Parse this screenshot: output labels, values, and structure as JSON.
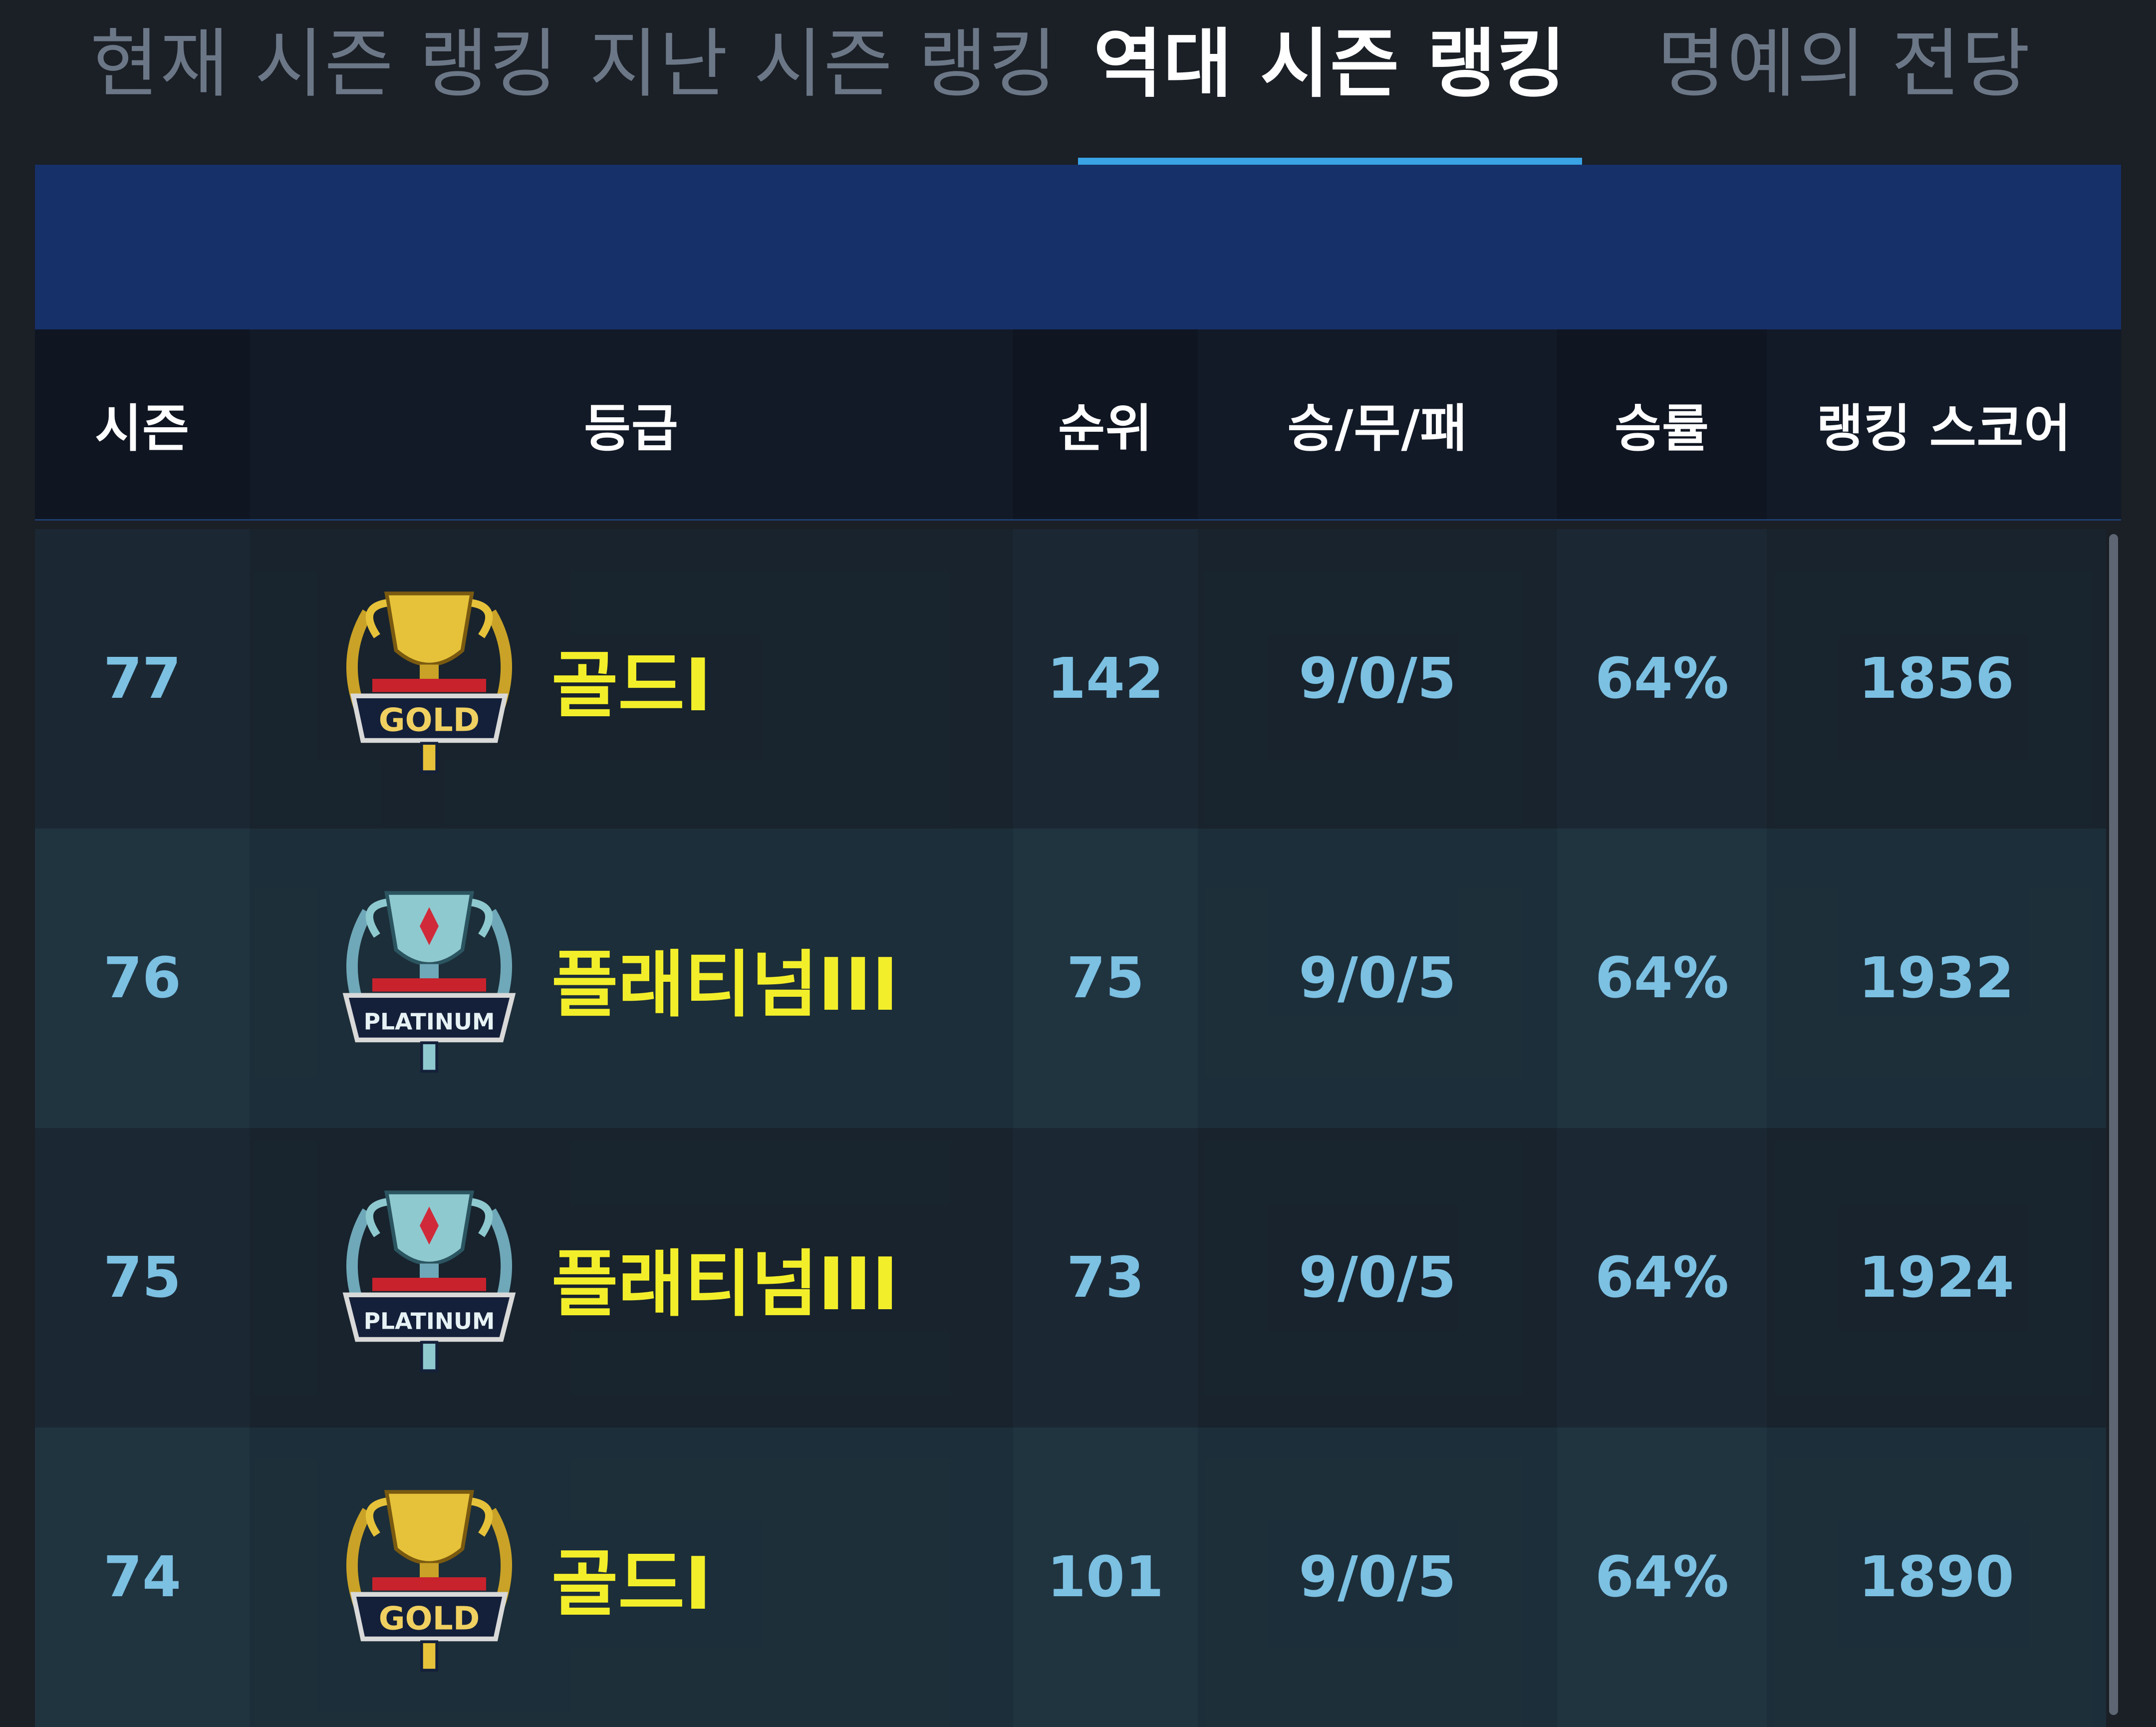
{
  "tabs": [
    {
      "label": "현재 시즌 랭킹",
      "active": false
    },
    {
      "label": "지난 시즌 랭킹",
      "active": false
    },
    {
      "label": "역대 시즌 랭킹",
      "active": true
    },
    {
      "label": "명예의 전당",
      "active": false
    }
  ],
  "table": {
    "headers": {
      "season": "시즌",
      "grade": "등급",
      "rank": "순위",
      "record": "승/무/패",
      "win_rate": "승률",
      "score": "랭킹 스코어"
    },
    "rows": [
      {
        "season": "77",
        "badge": "GOLD",
        "grade": "골드I",
        "rank": "142",
        "record": "9/0/5",
        "win_rate": "64%",
        "score": "1856"
      },
      {
        "season": "76",
        "badge": "PLATINUM",
        "grade": "플래티넘III",
        "rank": "75",
        "record": "9/0/5",
        "win_rate": "64%",
        "score": "1932"
      },
      {
        "season": "75",
        "badge": "PLATINUM",
        "grade": "플래티넘III",
        "rank": "73",
        "record": "9/0/5",
        "win_rate": "64%",
        "score": "1924"
      },
      {
        "season": "74",
        "badge": "GOLD",
        "grade": "골드I",
        "rank": "101",
        "record": "9/0/5",
        "win_rate": "64%",
        "score": "1890"
      }
    ]
  },
  "colors": {
    "background": "#1b1f26",
    "tab_active_indicator": "#3aa3e6",
    "banner": "#163069",
    "value_text": "#7cc0e2",
    "grade_text": "#f3ee2a"
  },
  "icons": {
    "gold_badge": "gold-trophy-emblem-icon",
    "platinum_badge": "platinum-trophy-emblem-icon"
  }
}
